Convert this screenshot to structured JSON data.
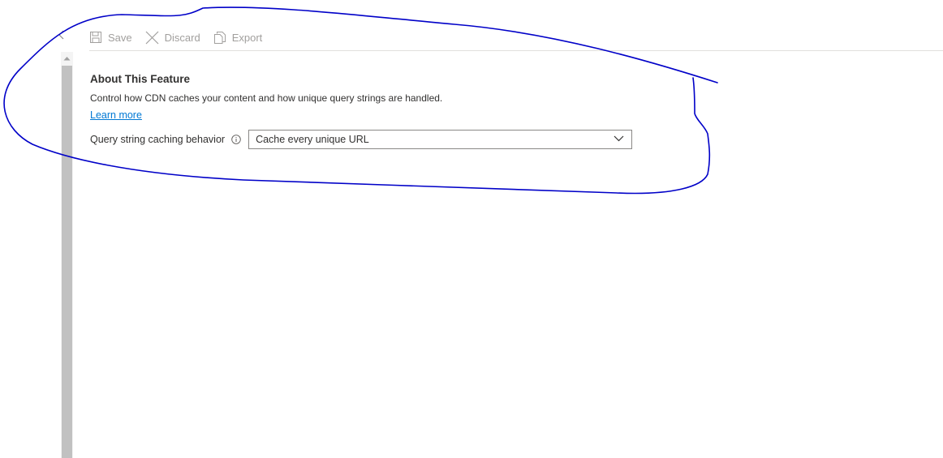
{
  "toolbar": {
    "save_label": "Save",
    "discard_label": "Discard",
    "export_label": "Export"
  },
  "feature": {
    "title": "About This Feature",
    "description": "Control how CDN caches your content and how unique query strings are handled.",
    "learn_more": "Learn more"
  },
  "query_string": {
    "label": "Query string caching behavior",
    "selected_value": "Cache every unique URL"
  },
  "colors": {
    "link": "#0078d4",
    "disabled_text": "#a19f9d",
    "annotation_ink": "#0000c8"
  },
  "icons": {
    "collapse": "chevron-left-icon",
    "save": "save-icon",
    "discard": "close-icon",
    "export": "copy-icon",
    "info": "info-icon",
    "dropdown": "chevron-down-icon"
  }
}
